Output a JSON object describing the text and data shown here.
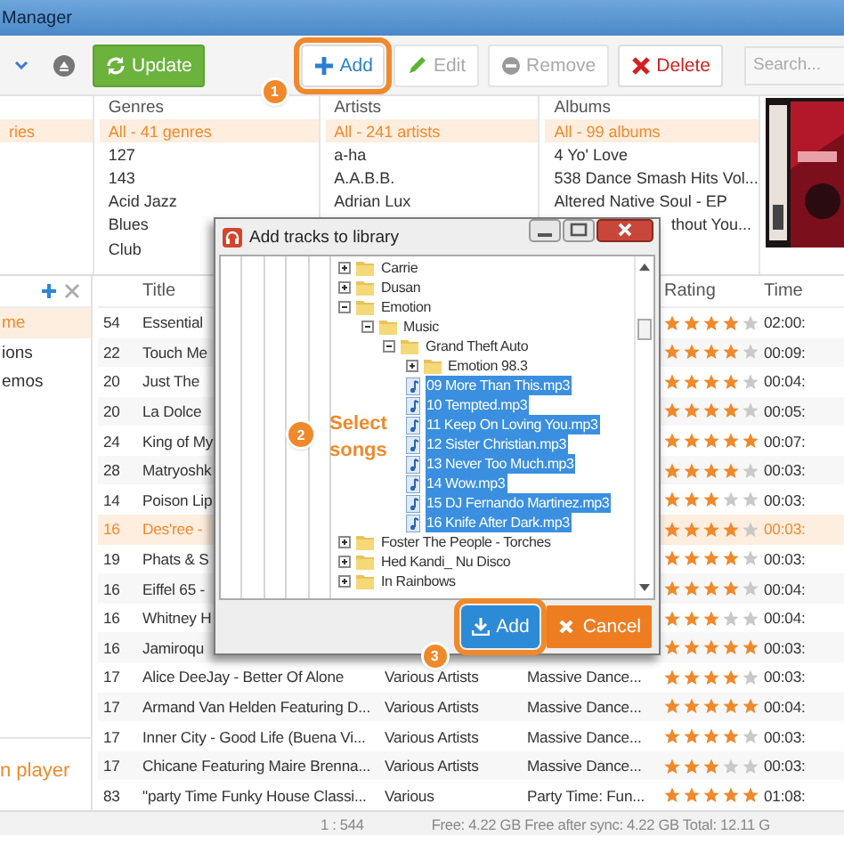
{
  "window": {
    "title": "Manager"
  },
  "toolbar": {
    "buttons": [
      {
        "kind": "update",
        "label": "Update",
        "disabled": false
      },
      {
        "kind": "add",
        "label": "Add",
        "disabled": false,
        "step": "1"
      },
      {
        "kind": "edit",
        "label": "Edit",
        "disabled": true
      },
      {
        "kind": "remove",
        "label": "Remove",
        "disabled": true
      },
      {
        "kind": "delete",
        "label": "Delete",
        "disabled": false
      }
    ],
    "search": {
      "placeholder": "Search..."
    }
  },
  "browser": {
    "columns": [
      {
        "items": [
          {
            "label": "ries",
            "selected": true
          }
        ]
      },
      {
        "title": "Genres",
        "items": [
          {
            "label": "All - 41 genres",
            "selected": true
          },
          {
            "label": "127",
            "selected": false
          },
          {
            "label": "143",
            "selected": false
          },
          {
            "label": "Acid Jazz",
            "selected": false
          },
          {
            "label": "Blues",
            "selected": false
          },
          {
            "label": "Club",
            "selected": false
          }
        ]
      },
      {
        "title": "Artists",
        "items": [
          {
            "label": "All - 241 artists",
            "selected": true
          },
          {
            "label": "a-ha",
            "selected": false
          },
          {
            "label": "A.A.B.B.",
            "selected": false
          },
          {
            "label": "Adrian Lux",
            "selected": false
          }
        ]
      },
      {
        "title": "Albums",
        "items": [
          {
            "label": "All - 99 albums",
            "selected": true,
            "covered": false
          },
          {
            "label": "4 Yo' Love",
            "selected": false,
            "covered": false
          },
          {
            "label": "538 Dance Smash Hits Vol...",
            "selected": false,
            "covered": false
          },
          {
            "label": "Altered Native Soul - EP",
            "selected": false,
            "covered": false
          },
          {
            "label": "thout You...",
            "selected": false,
            "covered": true
          }
        ]
      }
    ]
  },
  "side_panel": {
    "items": [
      {
        "label": "me",
        "selected": true
      },
      {
        "label": "ions",
        "selected": false
      },
      {
        "label": "emos",
        "selected": false
      }
    ],
    "footer_link": "n player"
  },
  "tracks": {
    "columns": [
      {
        "kind": "title",
        "label": "Title"
      },
      {
        "kind": "rating",
        "label": "Rating"
      },
      {
        "kind": "time",
        "label": "Time"
      }
    ],
    "rows": [
      {
        "number": "54",
        "title": "Essential",
        "stars": 4,
        "time": "02:00:",
        "selected": false
      },
      {
        "number": "22",
        "title": "Touch Me",
        "stars": 4,
        "time": "00:09:",
        "selected": false
      },
      {
        "number": "20",
        "title": "Just The",
        "stars": 4,
        "time": "00:04:",
        "selected": false
      },
      {
        "number": "20",
        "title": "La Dolce",
        "stars": 4,
        "time": "00:05:",
        "selected": false
      },
      {
        "number": "24",
        "title": "King of My",
        "stars": 5,
        "time": "00:07:",
        "selected": false
      },
      {
        "number": "28",
        "title": "Matryoshk",
        "stars": 4,
        "time": "00:03:",
        "selected": false
      },
      {
        "number": "14",
        "title": "Poison Lip",
        "stars": 3,
        "time": "00:03:",
        "selected": false
      },
      {
        "number": "16",
        "title": "Des'ree -",
        "stars": 4,
        "time": "00:03:",
        "selected": true
      },
      {
        "number": "19",
        "title": "Phats & S",
        "stars": 4,
        "time": "00:03:",
        "selected": false
      },
      {
        "number": "16",
        "title": "Eiffel 65 -",
        "stars": 4,
        "time": "00:04:",
        "selected": false
      },
      {
        "number": "16",
        "title": "Whitney H",
        "stars": 3,
        "time": "00:04:",
        "selected": false
      },
      {
        "number": "16",
        "title": "Jamiroqu",
        "stars": 5,
        "time": "00:03:",
        "selected": false
      },
      {
        "number": "17",
        "title": "Alice DeeJay - Better Of Alone",
        "artist": "Various Artists",
        "album": "Massive Dance...",
        "stars": 4,
        "time": "00:03:",
        "selected": false
      },
      {
        "number": "17",
        "title": "Armand Van Helden Featuring D...",
        "artist": "Various Artists",
        "album": "Massive Dance...",
        "stars": 5,
        "time": "00:04:",
        "selected": false
      },
      {
        "number": "17",
        "title": "Inner City - Good Life (Buena Vi...",
        "artist": "Various Artists",
        "album": "Massive Dance...",
        "stars": 4,
        "time": "00:03:",
        "selected": false
      },
      {
        "number": "17",
        "title": "Chicane Featuring Maire Brenna...",
        "artist": "Various Artists",
        "album": "Massive Dance...",
        "stars": 3,
        "time": "00:03:",
        "selected": false
      },
      {
        "number": "83",
        "title": "\"party Time Funky House Classi...",
        "artist": "Various",
        "album": "Party Time: Fun...",
        "stars": 5,
        "time": "01:08:",
        "selected": false
      }
    ]
  },
  "status_bar": {
    "position": "1 : 544",
    "storage": "Free: 4.22 GB Free after sync: 4.22 GB Total: 12.11 G"
  },
  "dialog": {
    "title": "Add tracks to library",
    "step": "2",
    "step_text": "Select songs",
    "tree": [
      {
        "label": "Carrie",
        "kind": "folder",
        "expanded": false
      },
      {
        "label": "Dusan",
        "kind": "folder",
        "expanded": false
      },
      {
        "label": "Emotion",
        "kind": "folder",
        "expanded": true,
        "children": [
          {
            "label": "Music",
            "kind": "folder",
            "expanded": true,
            "children": [
              {
                "label": "Grand Theft Auto",
                "kind": "folder",
                "expanded": true,
                "children": [
                  {
                    "label": "Emotion 98.3",
                    "kind": "folder",
                    "expanded": false
                  },
                  {
                    "label": "09 More Than This.mp3",
                    "kind": "file",
                    "selected": true
                  },
                  {
                    "label": "10 Tempted.mp3",
                    "kind": "file",
                    "selected": true
                  },
                  {
                    "label": "11 Keep On Loving You.mp3",
                    "kind": "file",
                    "selected": true
                  },
                  {
                    "label": "12 Sister Christian.mp3",
                    "kind": "file",
                    "selected": true
                  },
                  {
                    "label": "13 Never Too Much.mp3",
                    "kind": "file",
                    "selected": true
                  },
                  {
                    "label": "14 Wow.mp3",
                    "kind": "file",
                    "selected": true
                  },
                  {
                    "label": "15 DJ Fernando Martinez.mp3",
                    "kind": "file",
                    "selected": true
                  },
                  {
                    "label": "16 Knife After Dark.mp3",
                    "kind": "file",
                    "selected": true
                  }
                ]
              }
            ]
          }
        ]
      },
      {
        "label": "Foster The People - Torches",
        "kind": "folder",
        "expanded": false
      },
      {
        "label": "Hed Kandi_ Nu Disco",
        "kind": "folder",
        "expanded": false
      },
      {
        "label": "In Rainbows",
        "kind": "folder",
        "expanded": false
      }
    ],
    "buttons": [
      {
        "kind": "add",
        "label": "Add",
        "step": "3"
      },
      {
        "kind": "cancel",
        "label": "Cancel"
      }
    ]
  }
}
